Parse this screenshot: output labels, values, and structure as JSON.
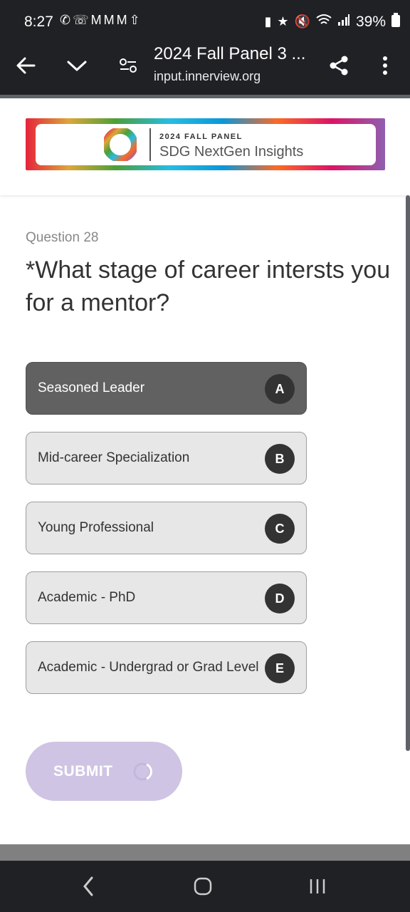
{
  "status_bar": {
    "time": "8:27",
    "battery": "39%",
    "left_icons": [
      "whatsapp-icon",
      "call-icon",
      "gmail-icon",
      "gmail-icon",
      "gmail-icon",
      "upload-icon"
    ],
    "right_icons": [
      "battery-saver-icon",
      "star-icon",
      "mute-icon",
      "wifi-icon",
      "signal-icon",
      "battery-icon"
    ]
  },
  "browser": {
    "title": "2024 Fall Panel 3 ...",
    "url": "input.innerview.org"
  },
  "banner": {
    "kicker": "2024 FALL PANEL",
    "title": "SDG NextGen Insights"
  },
  "question": {
    "number": "Question 28",
    "text": "*What stage of career intersts you for a mentor?"
  },
  "choices": [
    {
      "label": "Seasoned Leader",
      "key": "A",
      "selected": true
    },
    {
      "label": "Mid-career Specialization",
      "key": "B",
      "selected": false
    },
    {
      "label": "Young Professional",
      "key": "C",
      "selected": false
    },
    {
      "label": "Academic - PhD",
      "key": "D",
      "selected": false
    },
    {
      "label": "Academic - Undergrad or Grad Level",
      "key": "E",
      "selected": false
    }
  ],
  "submit": {
    "label": "SUBMIT"
  },
  "colors": {
    "selected_choice": "#616161",
    "choice_bg": "#e7e7e7",
    "submit_bg": "#cfc4e4",
    "toolbar_bg": "#202124"
  }
}
